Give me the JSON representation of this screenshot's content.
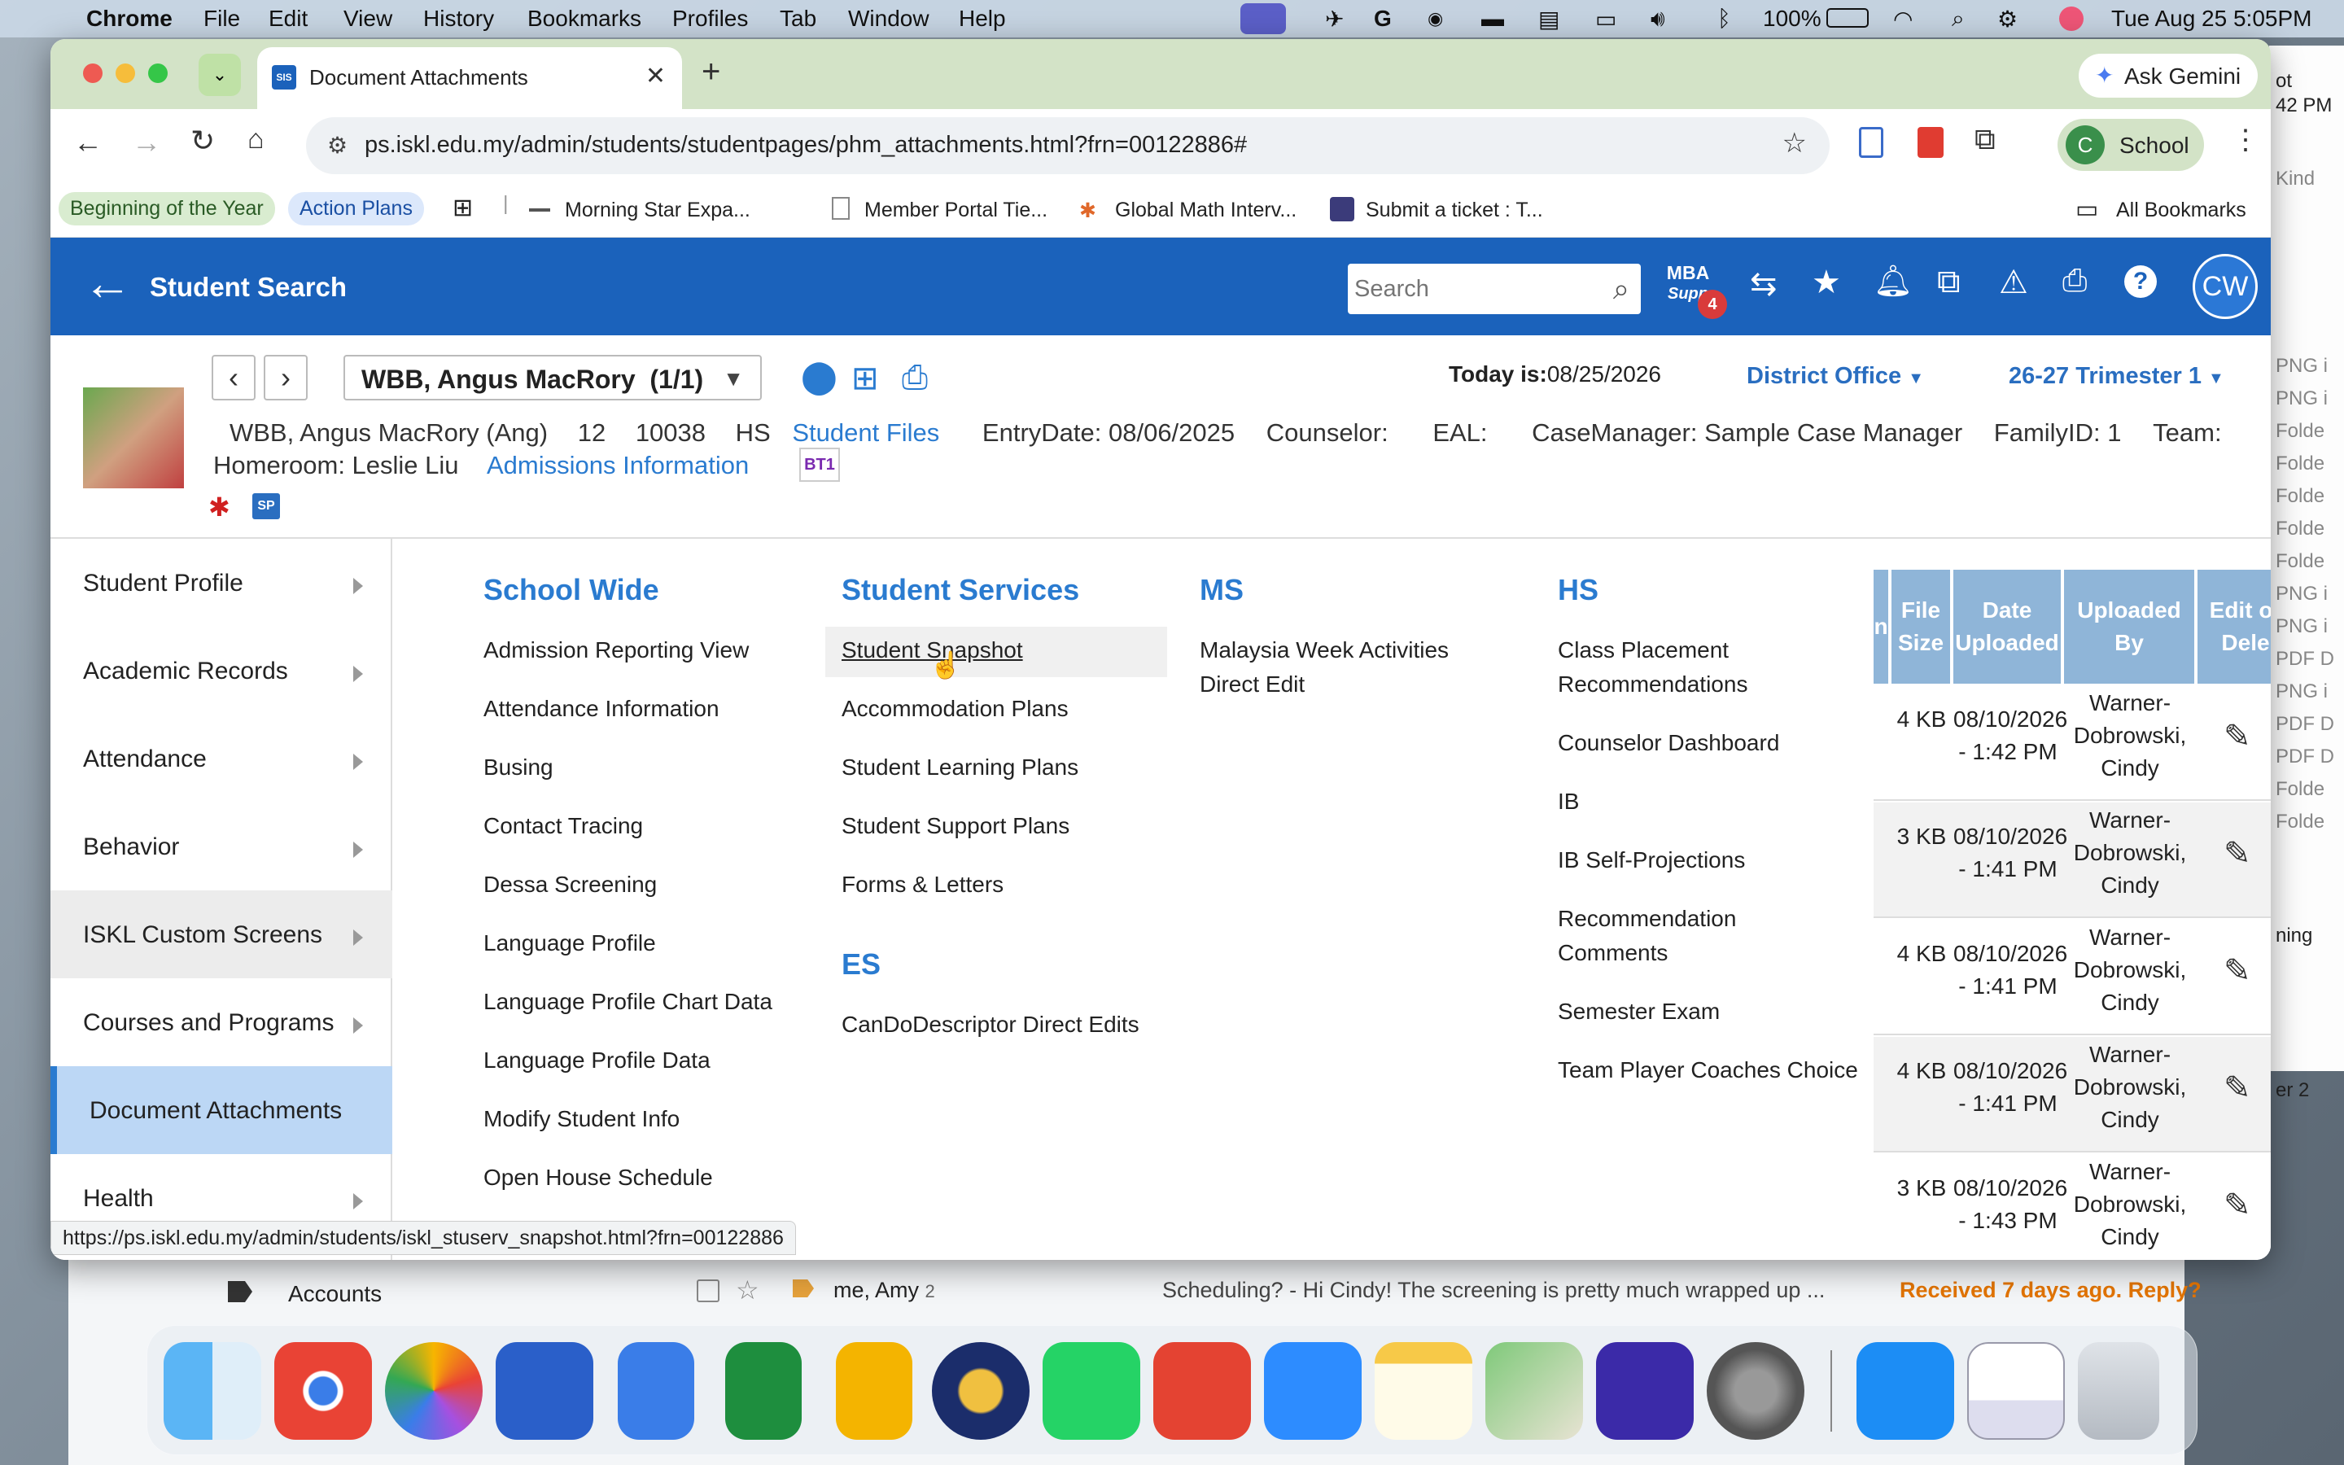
{
  "menubar": {
    "app_name": "Chrome",
    "items": [
      "File",
      "Edit",
      "View",
      "History",
      "Bookmarks",
      "Profiles",
      "Tab",
      "Window",
      "Help"
    ],
    "battery": "100%",
    "datetime": "Tue Aug 25  5:05PM"
  },
  "browser": {
    "tab_title": "Document Attachments",
    "tab_favicon": "SIS",
    "url": "ps.iskl.edu.my/admin/students/studentpages/phm_attachments.html?frn=00122886#",
    "ask_gemini": "Ask Gemini",
    "profile_initial": "C",
    "profile_label": "School",
    "bookmarks": [
      "Beginning of the Year",
      "Action Plans",
      "Morning Star Expa...",
      "Member Portal Tie...",
      "Global Math Interv...",
      "Submit a ticket : T..."
    ],
    "all_bookmarks": "All Bookmarks",
    "status_url": "https://ps.iskl.edu.my/admin/students/iskl_stuserv_snapshot.html?frn=00122886"
  },
  "header": {
    "back_label": "Student Search",
    "search_placeholder": "Search",
    "mba_label": "MBA",
    "mba_sub": "Supp",
    "mba_badge": "4",
    "user_initials": "CW"
  },
  "student": {
    "selector": "WBB, Angus MacRory  (1/1)",
    "today_label": "Today is:",
    "today_value": "08/25/2026",
    "district": "District Office",
    "term": "26-27 Trimester 1",
    "name_line": "WBB, Angus MacRory (Ang)",
    "grade": "12",
    "id": "10038",
    "school": "HS",
    "student_files": "Student Files",
    "entry_date": "EntryDate: 08/06/2025",
    "counselor": "Counselor:",
    "eal": "EAL:",
    "case_manager": "CaseManager: Sample Case Manager",
    "family_id": "FamilyID: 1",
    "team": "Team:",
    "homeroom": "Homeroom: Leslie Liu",
    "admissions": "Admissions Information",
    "badge_bt1": "BT1",
    "badge_sp": "SP"
  },
  "sidebar": {
    "items": [
      {
        "label": "Student Profile"
      },
      {
        "label": "Academic Records"
      },
      {
        "label": "Attendance"
      },
      {
        "label": "Behavior"
      },
      {
        "label": "ISKL Custom Screens"
      },
      {
        "label": "Courses and Programs"
      },
      {
        "label": "Document Attachments"
      },
      {
        "label": "Health"
      }
    ]
  },
  "menu": {
    "school_wide": {
      "title": "School Wide",
      "items": [
        "Admission Reporting View",
        "Attendance Information",
        "Busing",
        "Contact Tracing",
        "Dessa Screening",
        "Language Profile",
        "Language Profile Chart Data",
        "Language Profile Data",
        "Modify Student Info",
        "Open House Schedule"
      ]
    },
    "student_services": {
      "title": "Student Services",
      "items": [
        "Student Snapshot",
        "Accommodation Plans",
        "Student Learning Plans",
        "Student Support Plans",
        "Forms & Letters"
      ]
    },
    "es": {
      "title": "ES",
      "items": [
        "CanDoDescriptor Direct Edits"
      ]
    },
    "ms": {
      "title": "MS",
      "items": [
        "Malaysia Week Activities Direct Edit"
      ]
    },
    "hs": {
      "title": "HS",
      "items": [
        "Class Placement Recommendations",
        "Counselor Dashboard",
        "IB",
        "IB Self-Projections",
        "Recommendation Comments",
        "Semester Exam",
        "Team Player Coaches Choice"
      ]
    }
  },
  "table": {
    "headers": [
      "n",
      "File Size",
      "Date Uploaded",
      "Uploaded By",
      "Edit or Dele"
    ],
    "rows": [
      {
        "size": "4 KB",
        "date": "08/10/2026 - 1:42 PM",
        "by": "Warner-Dobrowski, Cindy"
      },
      {
        "size": "3 KB",
        "date": "08/10/2026 - 1:41 PM",
        "by": "Warner-Dobrowski, Cindy"
      },
      {
        "size": "4 KB",
        "date": "08/10/2026 - 1:41 PM",
        "by": "Warner-Dobrowski, Cindy"
      },
      {
        "size": "4 KB",
        "date": "08/10/2026 - 1:41 PM",
        "by": "Warner-Dobrowski, Cindy"
      },
      {
        "size": "3 KB",
        "date": "08/10/2026 - 1:43 PM",
        "by": "Warner-Dobrowski, Cindy"
      }
    ]
  },
  "background": {
    "accounts": "Accounts",
    "mail_from": "me, Amy",
    "mail_count": "2",
    "mail_subject": "Scheduling? - Hi Cindy! The screening is pretty much wrapped up ...",
    "mail_received": "Received 7 days ago. Reply?",
    "right_labels": [
      "Kind",
      "PNG i",
      "PNG i",
      "Folde",
      "Folde",
      "Folde",
      "Folde",
      "Folde",
      "PNG i",
      "PNG i",
      "PDF D",
      "PNG i",
      "PDF D",
      "PDF D",
      "Folde",
      "Folde",
      "ning",
      "er 2"
    ],
    "right_top": "ot",
    "right_top2": "42 PM"
  },
  "dock": {
    "apps": [
      "Finder",
      "Chrome",
      "Photos",
      "Keynote",
      "Docs",
      "Sheets",
      "Slides",
      "ISKL",
      "WhatsApp",
      "Todoist",
      "Zoom",
      "Notes",
      "Maps",
      "Gemini",
      "Settings",
      "App Store",
      "Preview",
      "Trash"
    ]
  }
}
